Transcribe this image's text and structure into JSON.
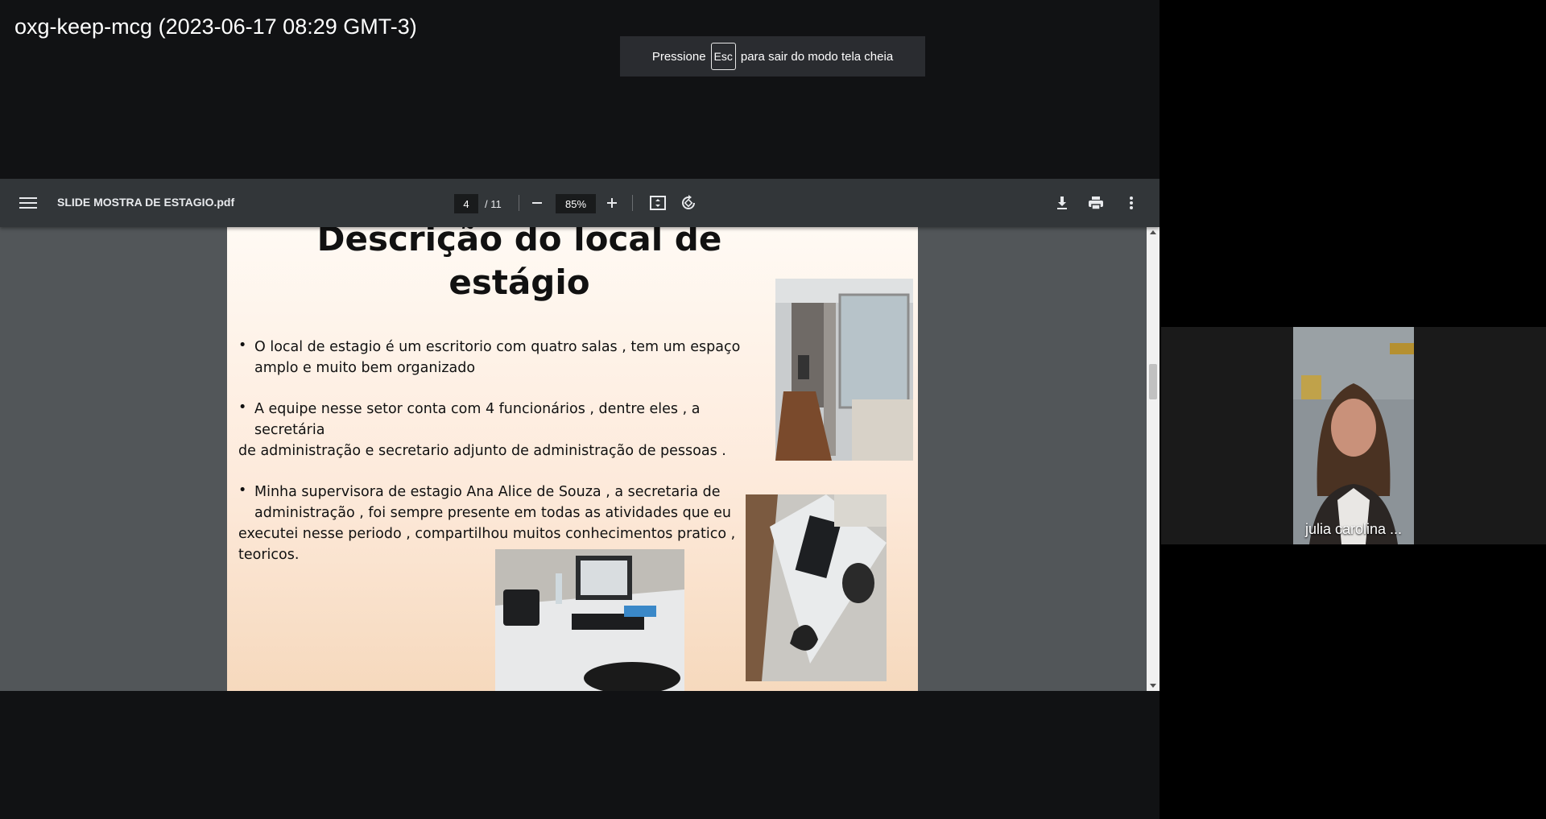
{
  "meeting": {
    "title": "oxg-keep-mcg (2023-06-17 08:29 GMT-3)"
  },
  "fullscreen_toast": {
    "prefix": "Pressione",
    "key": "Esc",
    "suffix": "para sair do modo tela cheia"
  },
  "pdf_viewer": {
    "filename": "SLIDE MOSTRA DE ESTAGIO.pdf",
    "page_current": "4",
    "page_total": "/ 11",
    "zoom": "85%",
    "icons": [
      "menu-icon",
      "zoom-out-icon",
      "zoom-in-icon",
      "fit-page-icon",
      "rotate-icon",
      "download-icon",
      "print-icon",
      "more-icon"
    ]
  },
  "slide": {
    "title_line1": "Descrição do local de",
    "title_line2": "estágio",
    "bullets": [
      {
        "line1": "O local de estagio é um escritorio com quatro salas  ,  tem um espaço",
        "line2": "amplo e muito bem organizado"
      },
      {
        "line1": "A equipe nesse setor conta com 4 funcionários , dentre eles , a secretária",
        "line2": "de administração e secretario adjunto de administração de pessoas ."
      },
      {
        "line1": "Minha supervisora de estagio Ana Alice de Souza , a secretaria de",
        "line2": "administração , foi sempre presente em todas as atividades que eu",
        "line3": "executei nesse periodo , compartilhou muitos conhecimentos pratico ,",
        "line4": "teoricos."
      }
    ]
  },
  "participant": {
    "name": "julia carolina ..."
  },
  "colors": {
    "toolbar": "#323639",
    "viewer_bg": "#525659",
    "stage_bg": "#111214"
  }
}
